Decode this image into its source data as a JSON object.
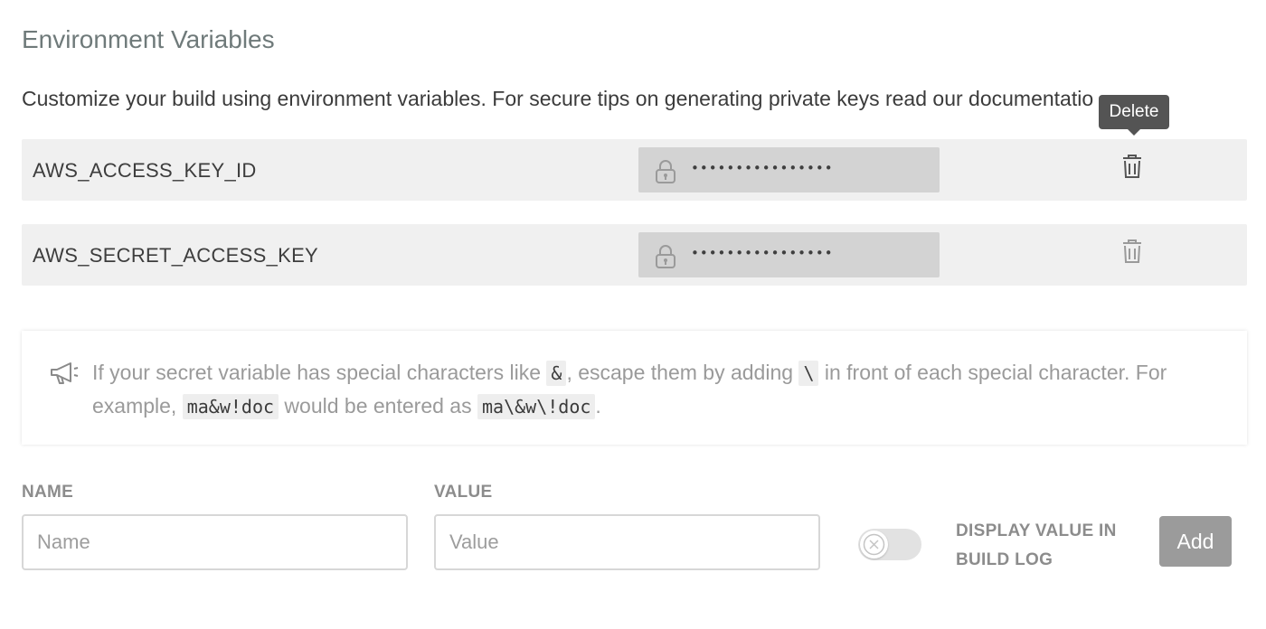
{
  "section": {
    "title": "Environment Variables",
    "intro_text": "Customize your build using environment variables. For secure tips on generating private keys ",
    "intro_link": "read our documentatio"
  },
  "variables": [
    {
      "name": "AWS_ACCESS_KEY_ID",
      "masked_value": "••••••••••••••••",
      "lock_icon": "lock-icon",
      "delete_icon": "trash-icon"
    },
    {
      "name": "AWS_SECRET_ACCESS_KEY",
      "masked_value": "••••••••••••••••",
      "lock_icon": "lock-icon",
      "delete_icon": "trash-icon"
    }
  ],
  "tooltip": {
    "text": "Delete"
  },
  "notice": {
    "icon": "megaphone-icon",
    "part1": "If your secret variable has special characters like ",
    "code1": "&",
    "part2": ", escape them by adding ",
    "code2": "\\",
    "part3": " in front of each special character. For example, ",
    "code3": "ma&w!doc",
    "part4": " would be entered as ",
    "code4": "ma\\&w\\!doc",
    "part5": "."
  },
  "form": {
    "name_label": "NAME",
    "name_placeholder": "Name",
    "value_label": "VALUE",
    "value_placeholder": "Value",
    "display_toggle_on": false,
    "display_label_line1": "DISPLAY VALUE IN",
    "display_label_line2": "BUILD LOG",
    "add_label": "Add"
  },
  "colors": {
    "row_bg": "#f0f0f0",
    "masked_bg": "#d3d3d3",
    "tooltip_bg": "#545454",
    "add_button_bg": "#9b9b9b"
  }
}
